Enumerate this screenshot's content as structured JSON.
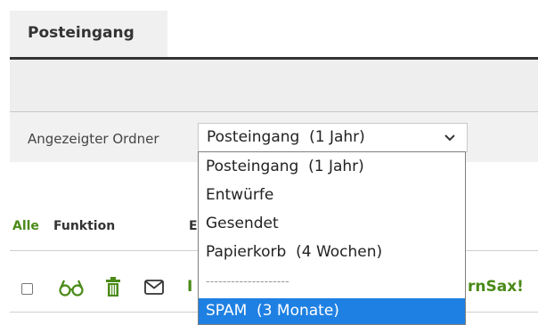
{
  "tab": {
    "label": "Posteingang"
  },
  "folder": {
    "label": "Angezeigter Ordner",
    "selected": "Posteingang  (1 Jahr)",
    "options": [
      "Posteingang  (1 Jahr)",
      "Entwürfe",
      "Gesendet",
      "Papierkorb  (4 Wochen)",
      "--------------------",
      "SPAM  (3 Monate)"
    ]
  },
  "columns": {
    "all": "Alle",
    "function": "Funktion",
    "third": "E"
  },
  "row": {
    "left_text": "I",
    "right_text": "rnSax!"
  },
  "colors": {
    "accent": "#4a8a18",
    "highlight": "#1e80e2"
  }
}
